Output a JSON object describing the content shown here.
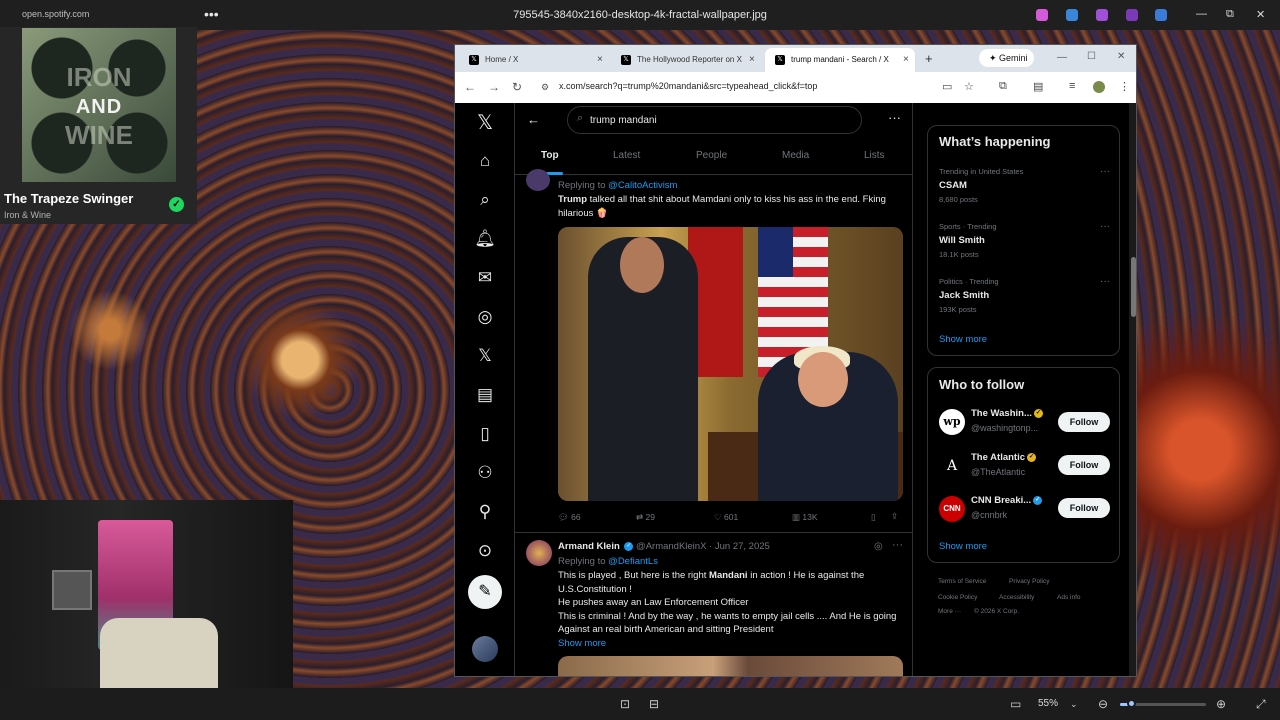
{
  "titlebar": {
    "title": "795545-3840x2160-desktop-4k-fractal-wallpaper.jpg",
    "site": "open.spotify.com",
    "menu": "•••",
    "controls": [
      "—",
      "⧉",
      "✕"
    ]
  },
  "spotify": {
    "album_art_text": [
      "IRON",
      "AND",
      "WINE"
    ],
    "song": "The Trapeze Swinger",
    "artist": "Iron & Wine",
    "saved_icon": "✓"
  },
  "browser": {
    "tabs": [
      {
        "label": "Home / X",
        "favicon": "𝕏"
      },
      {
        "label": "The Hollywood Reporter on X",
        "favicon": "𝕏"
      },
      {
        "label": "trump mandani - Search / X",
        "favicon": "𝕏"
      }
    ],
    "new_tab": "+",
    "gemini": "Gemini",
    "window_controls": [
      "—",
      "☐",
      "✕"
    ],
    "url": "x.com/search?q=trump%20mandani&src=typeahead_click&f=top"
  },
  "x": {
    "search_query": "trump mandani",
    "tabs": [
      "Top",
      "Latest",
      "People",
      "Media",
      "Lists"
    ],
    "tweet1": {
      "replying_label": "Replying to",
      "replying_to": "@CalitoActivism",
      "text_bold": "Trump",
      "text_rest": " talked all that shit about Mamdani only to kiss his ass in the end. Fking hilarious 🍿",
      "replies": "66",
      "reposts": "29",
      "likes": "601",
      "views": "13K"
    },
    "tweet2": {
      "name": "Armand Klein",
      "handle": "@ArmandKleinX · Jun 27, 2025",
      "replying_label": "Replying to",
      "replying_to": "@DefiantLs",
      "line1_a": "This is played , But here is the right ",
      "line1_bold": "Mandani",
      "line1_b": " in action !  He is against the U.S.Constitution !",
      "line2": "He pushes away an Law Enforcement Officer",
      "line3": "This is criminal ! And by the way , he wants to empty jail cells .... And He is going Against an real birth American and sitting President",
      "show_more": "Show more"
    },
    "whats_happening": {
      "title": "What’s happening",
      "trends": [
        {
          "meta": "Trending in United States",
          "name": "CSAM",
          "posts": "8,680 posts"
        },
        {
          "meta": "Sports · Trending",
          "name": "Will Smith",
          "posts": "18.1K posts"
        },
        {
          "meta": "Politics · Trending",
          "name": "Jack Smith",
          "posts": "193K posts"
        }
      ],
      "show_more": "Show more"
    },
    "who_to_follow": {
      "title": "Who to follow",
      "accounts": [
        {
          "name": "The Washin...",
          "handle": "@washingtonp...",
          "logo": "wp",
          "badge_color": "#e2b719"
        },
        {
          "name": "The Atlantic",
          "handle": "@TheAtlantic",
          "logo": "A",
          "badge_color": "#e2b719"
        },
        {
          "name": "CNN Breaki...",
          "handle": "@cnnbrk",
          "logo": "CNN",
          "badge_color": "#1d9bf0"
        }
      ],
      "follow_label": "Follow",
      "show_more": "Show more"
    },
    "footer": [
      "Terms of Service",
      "Privacy Policy",
      "Cookie Policy",
      "Accessibility",
      "Ads info",
      "More ···",
      "© 2026 X Corp."
    ]
  },
  "viewer": {
    "zoom": "55%"
  },
  "colors": {
    "accent": "#1d9bf0",
    "spotify_green": "#1ed760"
  }
}
